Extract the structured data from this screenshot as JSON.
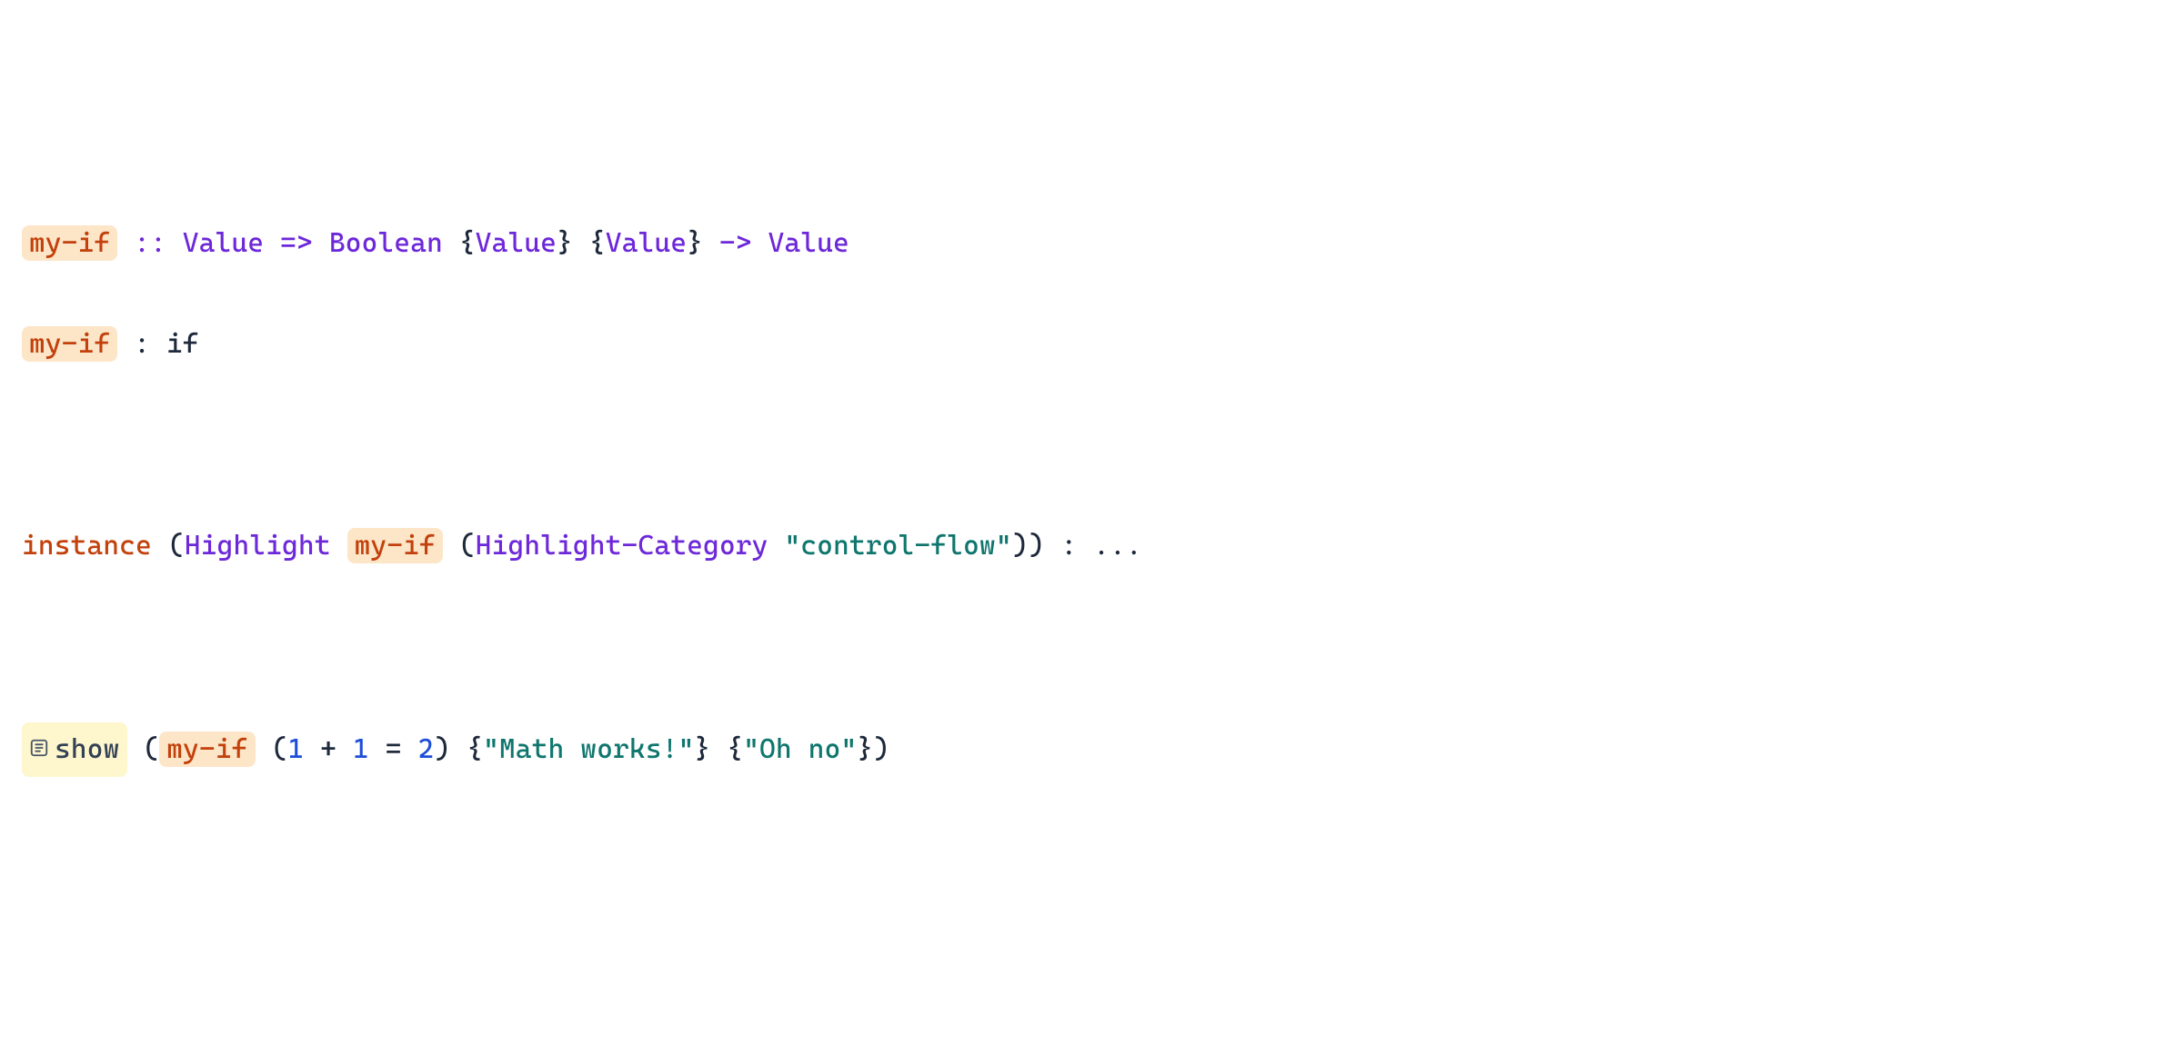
{
  "line1": {
    "fn": "my-if",
    "dcolon": " :: ",
    "t1": "Value",
    "arrow1": " => ",
    "t2": "Boolean",
    "sp": " ",
    "lb1": "{",
    "t3": "Value",
    "rb1": "}",
    "sp2": " ",
    "lb2": "{",
    "t4": "Value",
    "rb2": "}",
    "arrow2": " -> ",
    "t5": "Value"
  },
  "line2": {
    "fn": "my-if",
    "colon": " : ",
    "body": "if"
  },
  "line4": {
    "kw": "instance",
    "sp": " ",
    "lp": "(",
    "cls": "Highlight",
    "sp2": " ",
    "fn": "my-if",
    "sp3": " ",
    "lp2": "(",
    "cat": "Highlight-Category",
    "sp4": " ",
    "str": "\"control-flow\"",
    "rp2": ")",
    "rp": ")",
    "colon": " : ",
    "dots": "..."
  },
  "line6": {
    "showlabel": "show",
    "sp": " ",
    "lp": "(",
    "fn": "my-if",
    "sp2": " ",
    "lp2": "(",
    "n1": "1",
    "plus": " + ",
    "n2": "1",
    "eq": " = ",
    "n3": "2",
    "rp2": ")",
    "sp3": " ",
    "lb1": "{",
    "str1": "\"Math works!\"",
    "rb1": "}",
    "sp4": " ",
    "lb2": "{",
    "str2": "\"Oh no\"",
    "rb2": "}",
    "rp": ")"
  }
}
